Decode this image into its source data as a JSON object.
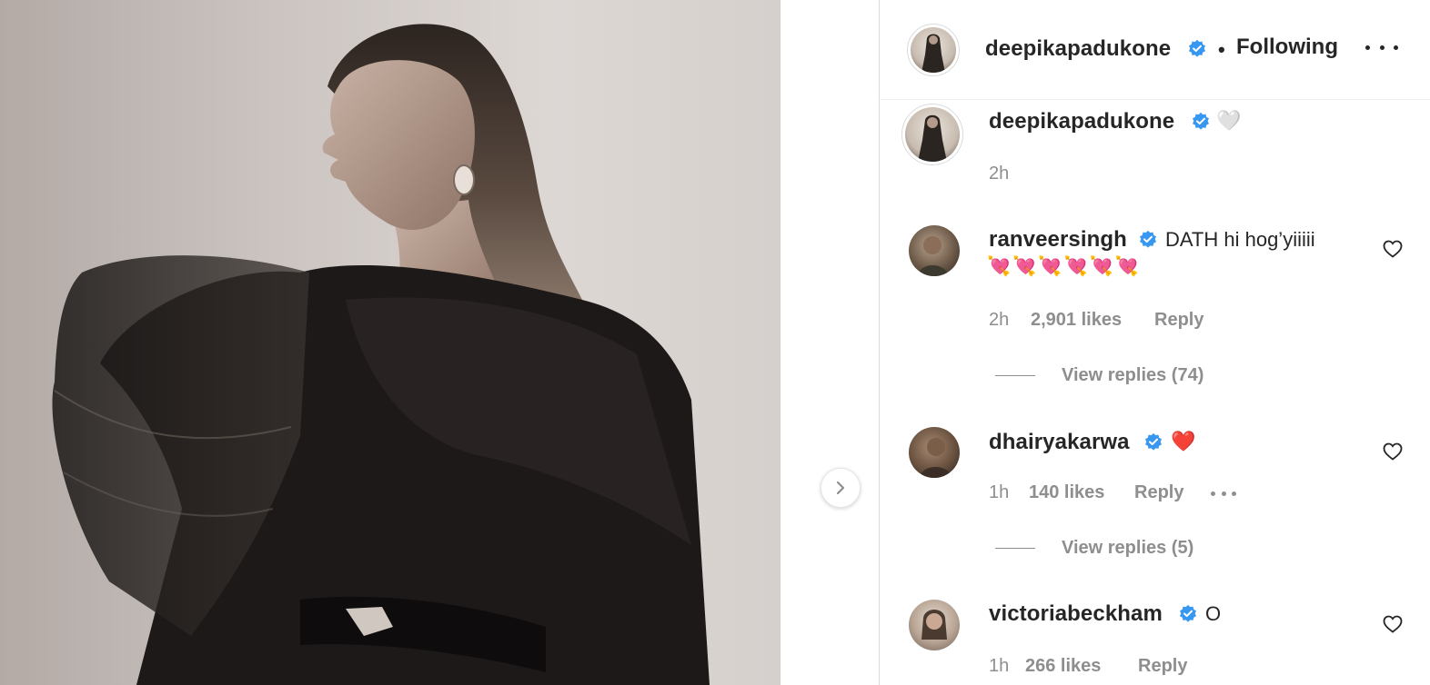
{
  "post": {
    "author": "deepikapadukone",
    "follow_status": "Following",
    "separator": "•",
    "next_icon": "chevron-right-icon",
    "more_icon": "more-horizontal-icon"
  },
  "caption": {
    "username": "deepikapadukone",
    "text": "🤍",
    "time": "2h"
  },
  "comments": [
    {
      "username": "ranveersingh",
      "text": "DATH hi hog’yiiiii",
      "emoji_line": "💘💘💘💘💘💘",
      "time": "2h",
      "likes": "2,901 likes",
      "reply": "Reply",
      "view_replies": "View replies (74)"
    },
    {
      "username": "dhairyakarwa",
      "text": "❤️",
      "time": "1h",
      "likes": "140 likes",
      "reply": "Reply",
      "view_replies": "View replies (5)"
    },
    {
      "username": "victoriabeckham",
      "text": "O",
      "time": "1h",
      "likes": "266 likes",
      "reply": "Reply"
    }
  ],
  "colors": {
    "verified": "#3897f0",
    "text": "#262626",
    "secondary": "#8e8e8e",
    "border": "#dbdbdb"
  }
}
